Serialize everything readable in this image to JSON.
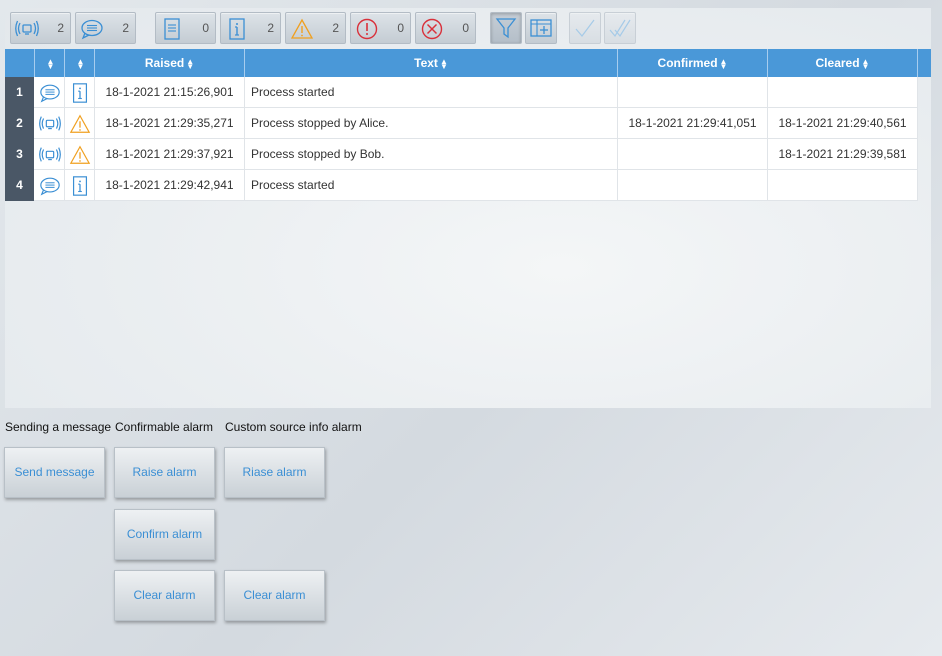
{
  "toolbar": {
    "counters": [
      {
        "name": "alarm-counter",
        "icon": "alarm-broadcast-icon",
        "count": "2"
      },
      {
        "name": "message-counter",
        "icon": "message-bubble-icon",
        "count": "2"
      },
      {
        "name": "document-counter",
        "icon": "document-icon",
        "count": "0"
      },
      {
        "name": "info-counter",
        "icon": "info-icon",
        "count": "2"
      },
      {
        "name": "warning-counter",
        "icon": "warning-icon",
        "count": "2"
      },
      {
        "name": "error-counter",
        "icon": "error-icon",
        "count": "0"
      },
      {
        "name": "critical-counter",
        "icon": "critical-x-icon",
        "count": "0"
      }
    ],
    "tools": [
      "filter-icon",
      "add-column-icon",
      "confirm-icon",
      "confirm-all-icon"
    ]
  },
  "grid": {
    "headers": {
      "col1": "",
      "col2": "",
      "raised": "Raised",
      "text": "Text",
      "confirmed": "Confirmed",
      "cleared": "Cleared"
    },
    "rows": [
      {
        "num": "1",
        "type_icon": "message-bubble-icon",
        "class_icon": "info-icon",
        "raised": "18-1-2021 21:15:26,901",
        "text": "Process started",
        "confirmed": "",
        "cleared": ""
      },
      {
        "num": "2",
        "type_icon": "alarm-broadcast-icon",
        "class_icon": "warning-icon",
        "raised": "18-1-2021 21:29:35,271",
        "text": "Process stopped by Alice.",
        "confirmed": "18-1-2021 21:29:41,051",
        "cleared": "18-1-2021 21:29:40,561"
      },
      {
        "num": "3",
        "type_icon": "alarm-broadcast-icon",
        "class_icon": "warning-icon",
        "raised": "18-1-2021 21:29:37,921",
        "text": "Process stopped by Bob.",
        "confirmed": "",
        "cleared": "18-1-2021 21:29:39,581"
      },
      {
        "num": "4",
        "type_icon": "message-bubble-icon",
        "class_icon": "info-icon",
        "raised": "18-1-2021 21:29:42,941",
        "text": "Process started",
        "confirmed": "",
        "cleared": ""
      }
    ]
  },
  "sections": {
    "message": {
      "label": "Sending a message",
      "send": "Send message"
    },
    "confirmable": {
      "label": "Confirmable alarm",
      "raise": "Raise alarm",
      "confirm": "Confirm alarm",
      "clear": "Clear alarm"
    },
    "custom": {
      "label": "Custom source info alarm",
      "raise": "Riase alarm",
      "clear": "Clear alarm"
    }
  },
  "colors": {
    "header": "#4a98d8",
    "row_number": "#4a5766",
    "accent_text": "#3b8fd4",
    "warning": "#f0a020",
    "error": "#d9303a"
  }
}
